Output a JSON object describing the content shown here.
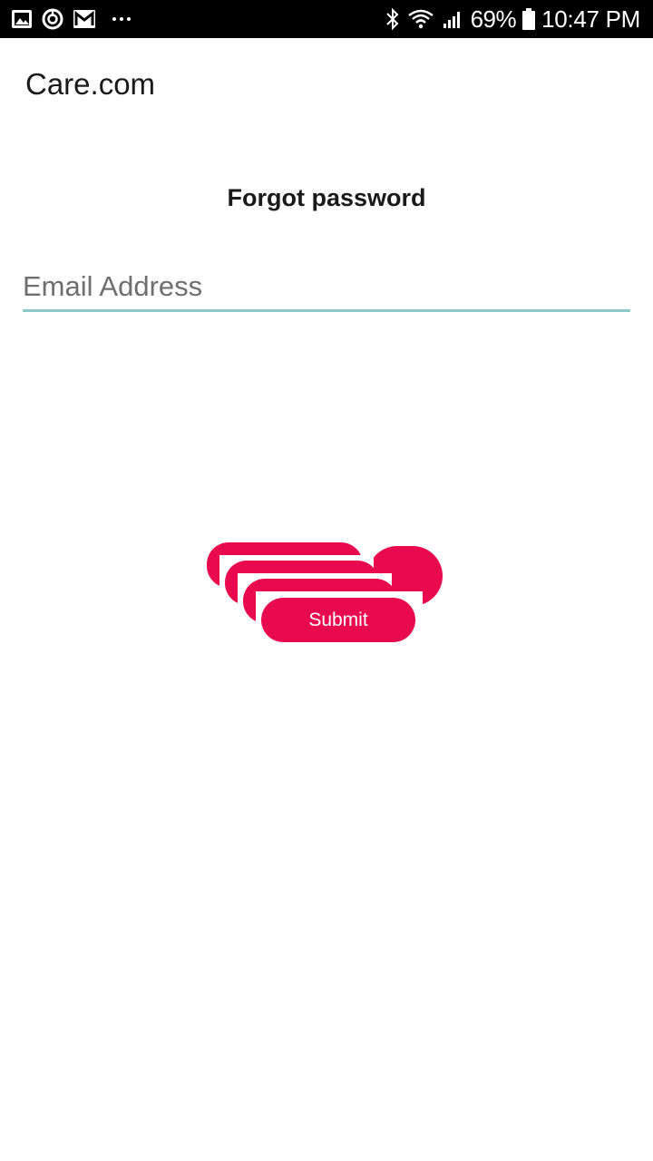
{
  "status_bar": {
    "left_icons": [
      "image-icon",
      "sync-icon",
      "gmail-icon"
    ],
    "right_icons": [
      "bluetooth-icon",
      "wifi-icon",
      "signal-icon",
      "battery-icon"
    ],
    "battery_percent": "69%",
    "time": "10:47 PM"
  },
  "header": {
    "app_title": "Care.com"
  },
  "main": {
    "page_title": "Forgot password",
    "email": {
      "placeholder": "Email Address",
      "value": ""
    },
    "submit_label": "Submit"
  },
  "colors": {
    "accent": "#e8094f",
    "field_underline": "#8ec9c9",
    "status_bar_bg": "#000000"
  }
}
